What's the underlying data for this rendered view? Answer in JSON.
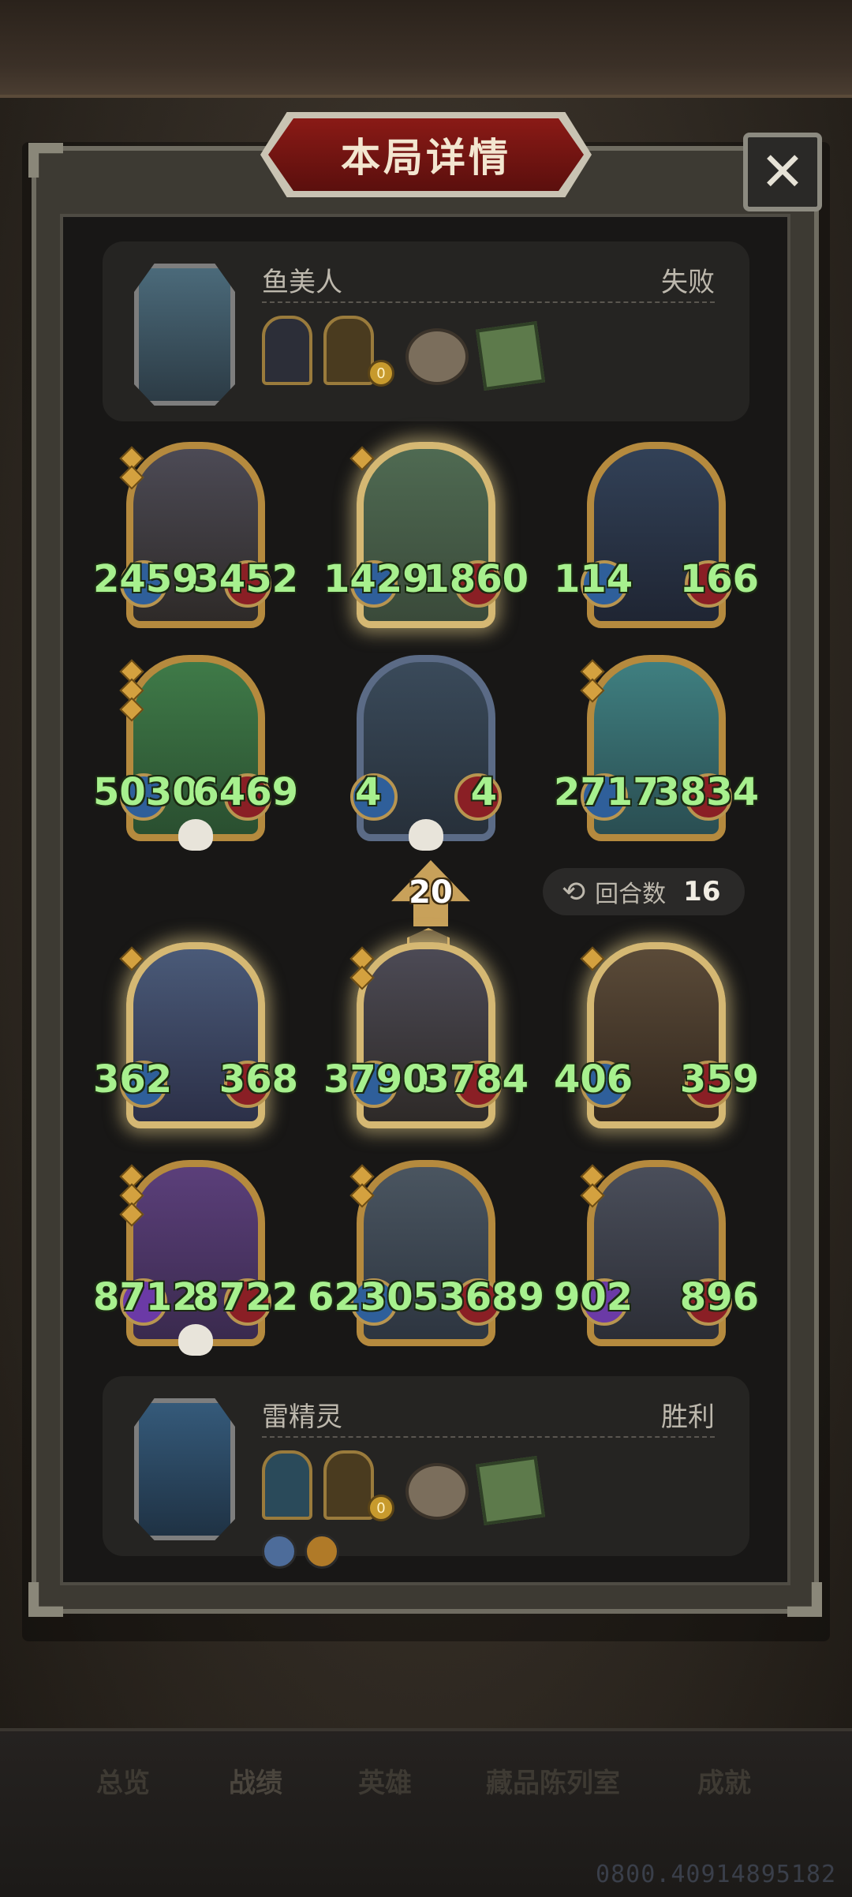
{
  "title": "本局详情",
  "close_label": "✕",
  "opponent": {
    "name": "鱼美人",
    "result": "失败",
    "coin": "0"
  },
  "player": {
    "name": "雷精灵",
    "result": "胜利",
    "coin": "0"
  },
  "rounds": {
    "label": "回合数",
    "value": "16"
  },
  "turn_marker": {
    "value": "20",
    "tier": "2"
  },
  "opponent_board": [
    {
      "atk": "2459",
      "hp": "3452"
    },
    {
      "atk": "1429",
      "hp": "1860"
    },
    {
      "atk": "114",
      "hp": "166"
    },
    {
      "atk": "5030",
      "hp": "6469"
    },
    {
      "atk": "4",
      "hp": "4"
    },
    {
      "atk": "2717",
      "hp": "3834"
    }
  ],
  "player_board": [
    {
      "atk": "362",
      "hp": "368"
    },
    {
      "atk": "3790",
      "hp": "3784"
    },
    {
      "atk": "406",
      "hp": "359"
    },
    {
      "atk": "8712",
      "hp": "8722"
    },
    {
      "atk": "62305",
      "hp": "53689"
    },
    {
      "atk": "902",
      "hp": "896"
    }
  ],
  "tabs": [
    "总览",
    "战绩",
    "英雄",
    "藏品陈列室",
    "成就"
  ],
  "watermark": "0800.40914895182",
  "colors": {
    "stat_text": "#a7f08e",
    "title_plate": "#8a1a16",
    "frame": "#b58a3e"
  }
}
